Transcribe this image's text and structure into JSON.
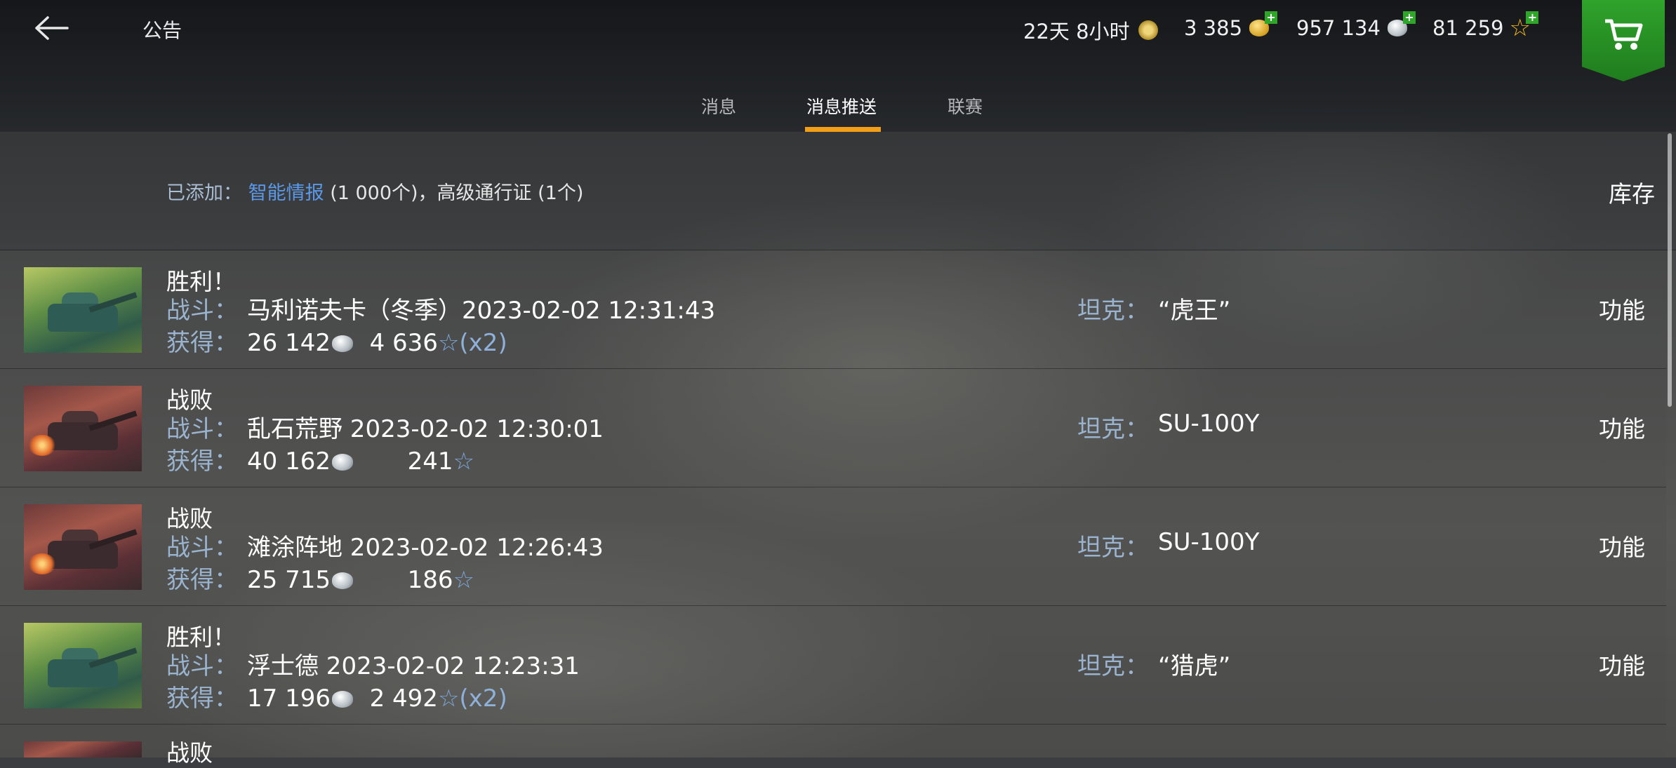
{
  "header": {
    "title": "公告",
    "premium": "22天 8小时",
    "gold": "3 385",
    "credits": "957 134",
    "free_xp": "81 259",
    "plus": "+"
  },
  "tabs": [
    {
      "label": "消息",
      "active": false
    },
    {
      "label": "消息推送",
      "active": true
    },
    {
      "label": "联赛",
      "active": false
    }
  ],
  "added": {
    "label": "已添加：",
    "link": "智能情报",
    "rest": "(1 000个)，高级通行证 (1个)",
    "inventory": "库存"
  },
  "labels": {
    "battle": "战斗：",
    "earned": "获得：",
    "tank": "坦克：",
    "function": "功能"
  },
  "rows": [
    {
      "result": "胜利！",
      "outcome": "win",
      "battle": "马利诺夫卡（冬季）2023-02-02 12:31:43",
      "credits": "26 142",
      "xp": "4 636",
      "mult": "(x2)",
      "tank": "“虎王”"
    },
    {
      "result": "战败",
      "outcome": "lose",
      "battle": "乱石荒野 2023-02-02 12:30:01",
      "credits": "40 162",
      "xp": "241",
      "mult": "",
      "tank": "SU-100Y"
    },
    {
      "result": "战败",
      "outcome": "lose",
      "battle": "滩涂阵地 2023-02-02 12:26:43",
      "credits": "25 715",
      "xp": "186",
      "mult": "",
      "tank": "SU-100Y"
    },
    {
      "result": "胜利！",
      "outcome": "win",
      "battle": "浮士德 2023-02-02 12:23:31",
      "credits": "17 196",
      "xp": "2 492",
      "mult": "(x2)",
      "tank": "“猎虎”"
    },
    {
      "result": "战败",
      "outcome": "lose"
    }
  ],
  "colors": {
    "accent_tab": "#f29e16",
    "link": "#5b98e8",
    "label_blue": "#9ab3cf",
    "shop_green": "#2fa32b"
  }
}
